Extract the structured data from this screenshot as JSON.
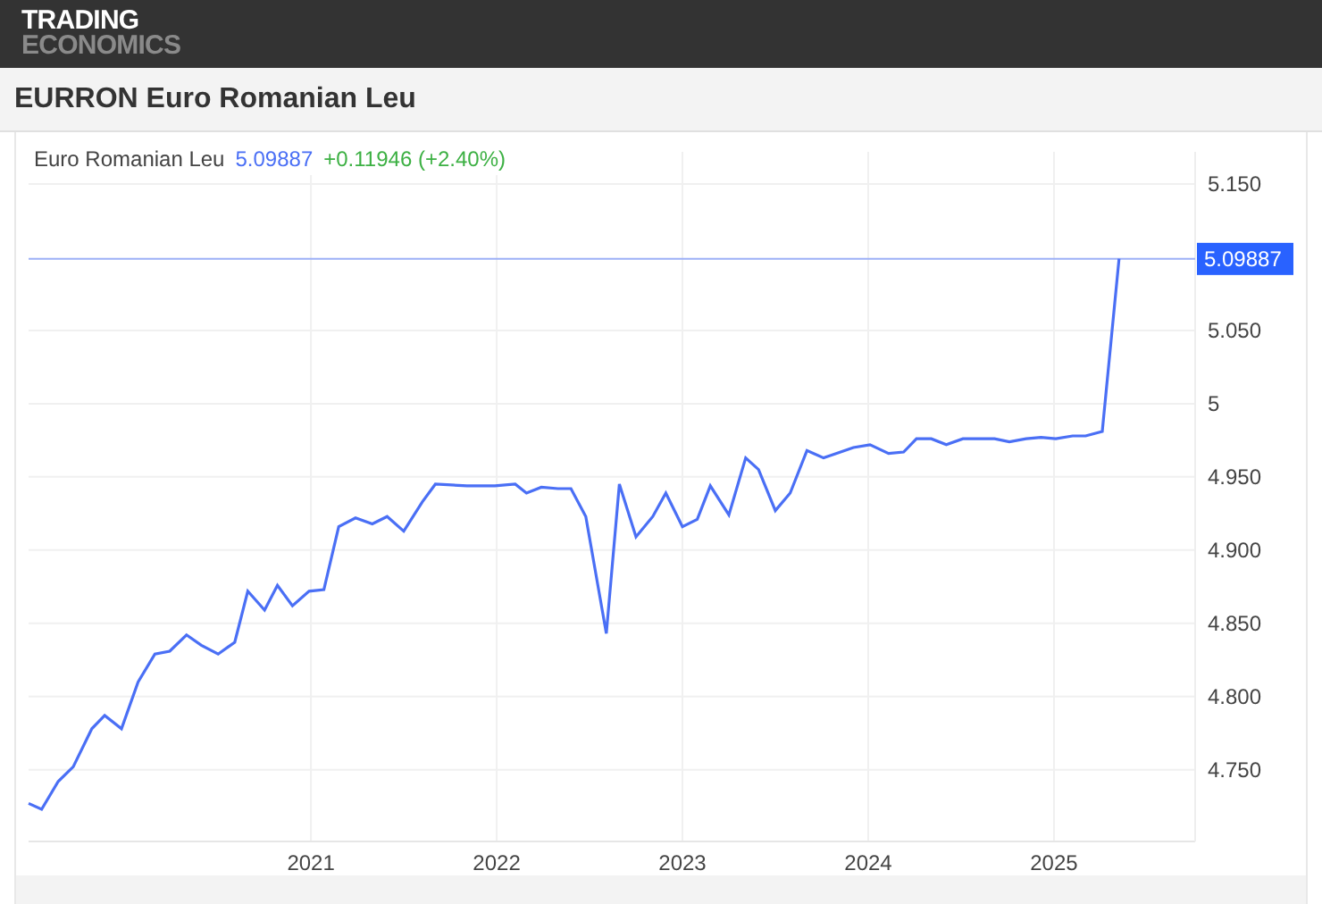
{
  "logo": {
    "line_1": "TRADING",
    "line_2": "ECONOMICS"
  },
  "title": "EURRON Euro Romanian Leu",
  "legend": {
    "value": "5.09887",
    "change": "+0.11946 (+2.40%)"
  },
  "chart_data": {
    "type": "line",
    "grid": true,
    "xlim": [
      2019.48,
      2025.76
    ],
    "ylim": [
      4.701,
      5.172
    ],
    "xticks": [
      2021,
      2022,
      2023,
      2024,
      2025
    ],
    "yticks": [
      {
        "value": 4.75,
        "label": "4.750"
      },
      {
        "value": 4.8,
        "label": "4.800"
      },
      {
        "value": 4.85,
        "label": "4.850"
      },
      {
        "value": 4.9,
        "label": "4.900"
      },
      {
        "value": 4.95,
        "label": "4.950"
      },
      {
        "value": 5,
        "label": "5"
      },
      {
        "value": 5.05,
        "label": "5.050"
      },
      {
        "value": 5.15,
        "label": "5.150"
      }
    ],
    "x": [
      2019.48,
      2019.55,
      2019.64,
      2019.72,
      2019.82,
      2019.89,
      2019.98,
      2020.07,
      2020.16,
      2020.24,
      2020.33,
      2020.41,
      2020.5,
      2020.59,
      2020.66,
      2020.75,
      2020.82,
      2020.9,
      2020.99,
      2021.07,
      2021.15,
      2021.24,
      2021.33,
      2021.41,
      2021.5,
      2021.6,
      2021.67,
      2021.84,
      2021.99,
      2022.1,
      2022.16,
      2022.24,
      2022.33,
      2022.4,
      2022.48,
      2022.59,
      2022.66,
      2022.75,
      2022.84,
      2022.91,
      2023.0,
      2023.08,
      2023.15,
      2023.25,
      2023.34,
      2023.41,
      2023.5,
      2023.58,
      2023.67,
      2023.76,
      2023.92,
      2024.01,
      2024.11,
      2024.19,
      2024.26,
      2024.34,
      2024.42,
      2024.51,
      2024.68,
      2024.76,
      2024.85,
      2024.93,
      2025.01,
      2025.1,
      2025.17,
      2025.26,
      2025.35
    ],
    "series": [
      {
        "name": "Euro Romanian Leu",
        "color": "#4a6ff5",
        "values": [
          4.727,
          4.723,
          4.742,
          4.752,
          4.778,
          4.787,
          4.778,
          4.81,
          4.829,
          4.831,
          4.842,
          4.835,
          4.829,
          4.837,
          4.872,
          4.859,
          4.876,
          4.862,
          4.872,
          4.873,
          4.916,
          4.922,
          4.918,
          4.923,
          4.913,
          4.933,
          4.945,
          4.944,
          4.944,
          4.945,
          4.939,
          4.943,
          4.942,
          4.942,
          4.923,
          4.843,
          4.945,
          4.909,
          4.923,
          4.939,
          4.916,
          4.921,
          4.944,
          4.924,
          4.963,
          4.955,
          4.927,
          4.939,
          4.968,
          4.963,
          4.97,
          4.972,
          4.966,
          4.967,
          4.976,
          4.976,
          4.972,
          4.976,
          4.976,
          4.974,
          4.976,
          4.977,
          4.976,
          4.978,
          4.978,
          4.981,
          5.099
        ]
      }
    ],
    "ref_lines": [
      {
        "axis": "y",
        "value": 5.09887,
        "label": "5.09887"
      }
    ]
  }
}
